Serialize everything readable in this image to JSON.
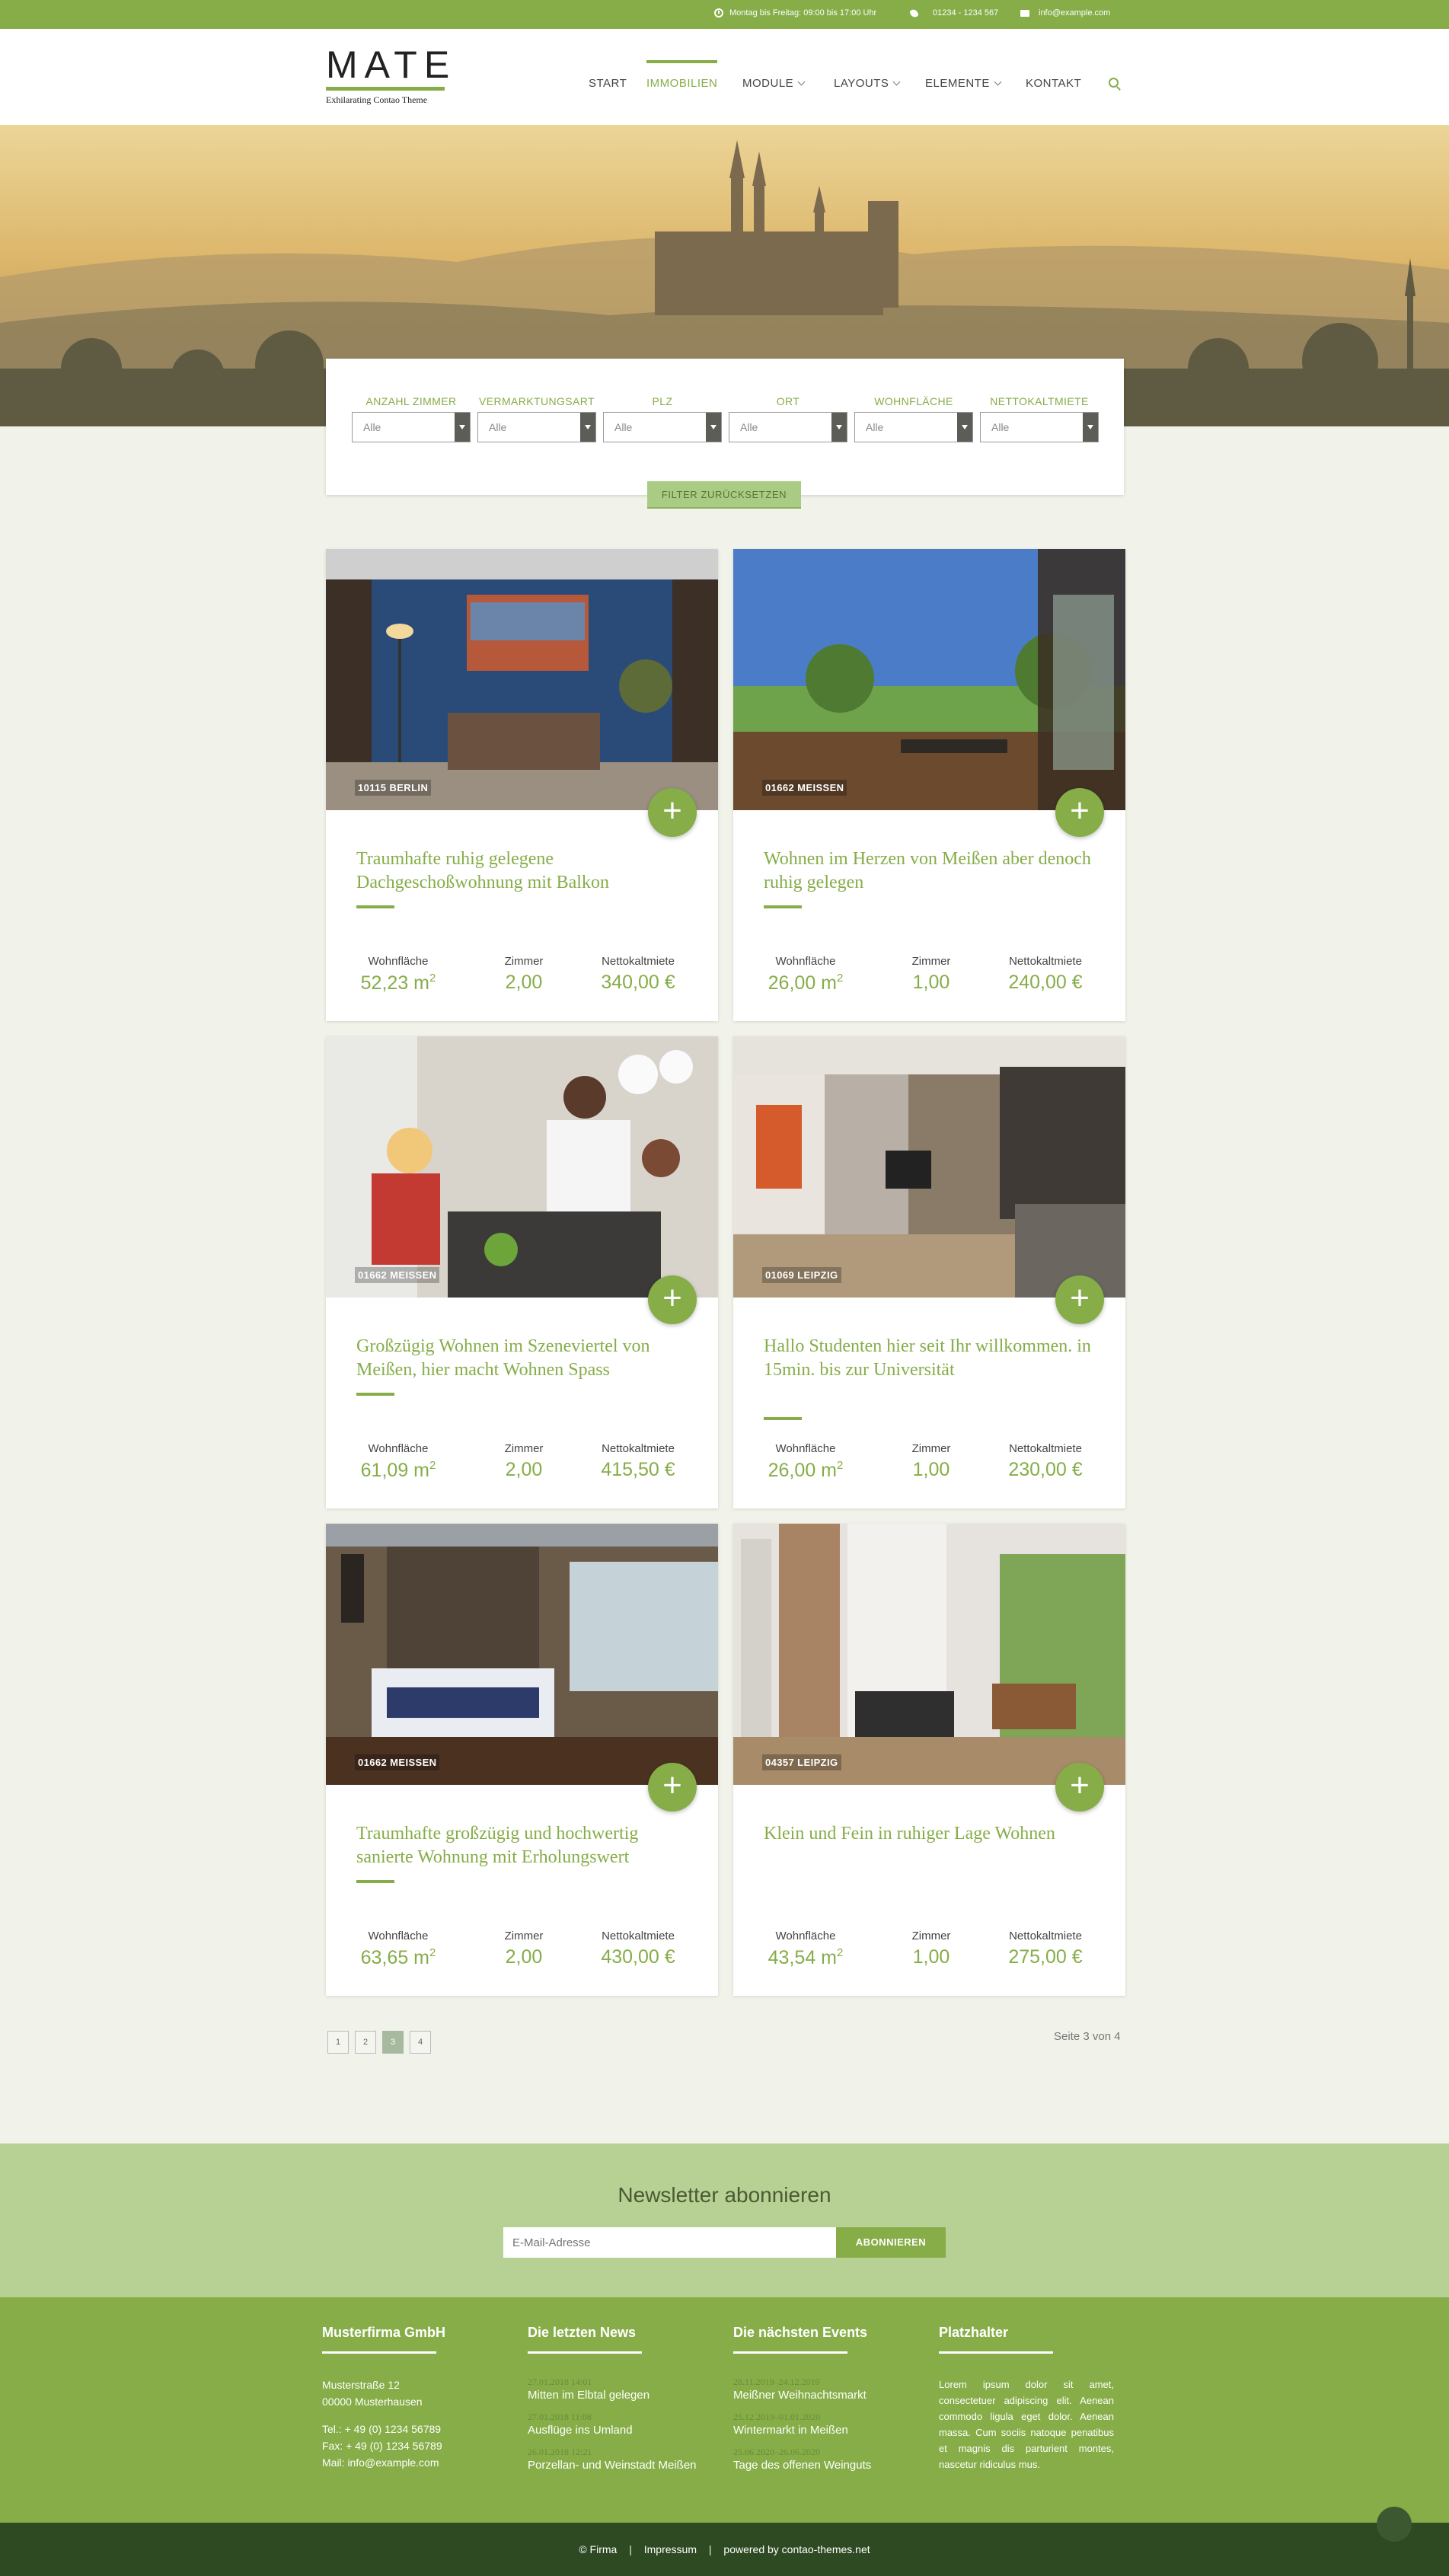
{
  "topbar": {
    "hours": "Montag bis Freitag: 09:00 bis 17:00 Uhr",
    "phone": "01234 - 1234 567",
    "email": "info@example.com"
  },
  "logo": {
    "word": "MATE",
    "tagline": "Exhilarating Contao Theme"
  },
  "nav": {
    "items": [
      {
        "label": "START"
      },
      {
        "label": "IMMOBILIEN"
      },
      {
        "label": "MODULE"
      },
      {
        "label": "LAYOUTS"
      },
      {
        "label": "ELEMENTE"
      },
      {
        "label": "KONTAKT"
      }
    ]
  },
  "filter": {
    "fields": [
      {
        "label": "ANZAHL ZIMMER",
        "value": "Alle"
      },
      {
        "label": "VERMARKTUNGSART",
        "value": "Alle"
      },
      {
        "label": "PLZ",
        "value": "Alle"
      },
      {
        "label": "ORT",
        "value": "Alle"
      },
      {
        "label": "WOHNFLÄCHE",
        "value": "Alle"
      },
      {
        "label": "NETTOKALTMIETE",
        "value": "Alle"
      }
    ],
    "reset_label": "FILTER ZURÜCKSETZEN"
  },
  "stat_labels": {
    "area": "Wohnfläche",
    "rooms": "Zimmer",
    "rent": "Nettokaltmiete"
  },
  "listings": [
    {
      "location": "10115 BERLIN",
      "title": "Traumhafte ruhig gelegene Dachgeschoßwohnung mit Balkon",
      "area": "52,23 m",
      "rooms": "2,00",
      "rent": "340,00 €"
    },
    {
      "location": "01662 MEISSEN",
      "title": "Wohnen im Herzen von Meißen aber denoch ruhig gelegen",
      "area": "26,00 m",
      "rooms": "1,00",
      "rent": "240,00 €"
    },
    {
      "location": "01662 MEISSEN",
      "title": "Großzügig Wohnen im Szeneviertel von Meißen, hier macht Wohnen Spass",
      "area": "61,09 m",
      "rooms": "2,00",
      "rent": "415,50 €"
    },
    {
      "location": "01069 LEIPZIG",
      "title": "Hallo Studenten hier seit Ihr willkommen. in 15min. bis zur Universität",
      "area": "26,00 m",
      "rooms": "1,00",
      "rent": "230,00 €"
    },
    {
      "location": "01662 MEISSEN",
      "title": "Traumhafte großzügig und hochwertig sanierte Wohnung mit Erholungswert",
      "area": "63,65 m",
      "rooms": "2,00",
      "rent": "430,00 €"
    },
    {
      "location": "04357 LEIPZIG",
      "title": "Klein und Fein in ruhiger Lage Wohnen",
      "area": "43,54 m",
      "rooms": "1,00",
      "rent": "275,00 €"
    }
  ],
  "area_sup": "2",
  "plus_symbol": "+",
  "pagination": {
    "pages": [
      "1",
      "2",
      "3",
      "4"
    ],
    "current": "3",
    "info": "Seite 3 von 4"
  },
  "newsletter": {
    "title": "Newsletter abonnieren",
    "placeholder": "E-Mail-Adresse",
    "button": "ABONNIEREN"
  },
  "footer": {
    "company": {
      "title": "Musterfirma GmbH",
      "street": "Musterstraße 12",
      "city": "00000 Musterhausen",
      "tel": "Tel.: + 49 (0) 1234 56789",
      "fax": "Fax: + 49 (0) 1234 56789",
      "mail": "Mail: info@example.com"
    },
    "news": {
      "title": "Die letzten News",
      "items": [
        {
          "date": "27.01.2018 14:01",
          "text": "Mitten im Elbtal gelegen"
        },
        {
          "date": "27.01.2018 11:08",
          "text": "Ausflüge ins Umland"
        },
        {
          "date": "26.01.2018 12:21",
          "text": "Porzellan- und Weinstadt Meißen"
        }
      ]
    },
    "events": {
      "title": "Die nächsten Events",
      "items": [
        {
          "date": "28.11.2019–24.12.2019",
          "text": "Meißner Weihnachtsmarkt"
        },
        {
          "date": "25.12.2019–01.01.2020",
          "text": "Wintermarkt in Meißen"
        },
        {
          "date": "25.06.2020–26.06.2020",
          "text": "Tage des offenen Weinguts"
        }
      ]
    },
    "placeholder": {
      "title": "Platzhalter",
      "text": "Lorem ipsum dolor sit amet, consectetuer adipiscing elit. Aenean commodo ligula eget dolor. Aenean massa. Cum sociis natoque penatibus et magnis dis parturient montes, nascetur ridiculus mus."
    }
  },
  "bottombar": {
    "copyright": "© Firma",
    "imprint": "Impressum",
    "powered": "powered by contao-themes.net",
    "separator": "|"
  },
  "colors": {
    "accent": "#86ad48",
    "newsletter_bg": "#b7d194",
    "bottom_bg": "#2e4a23"
  }
}
